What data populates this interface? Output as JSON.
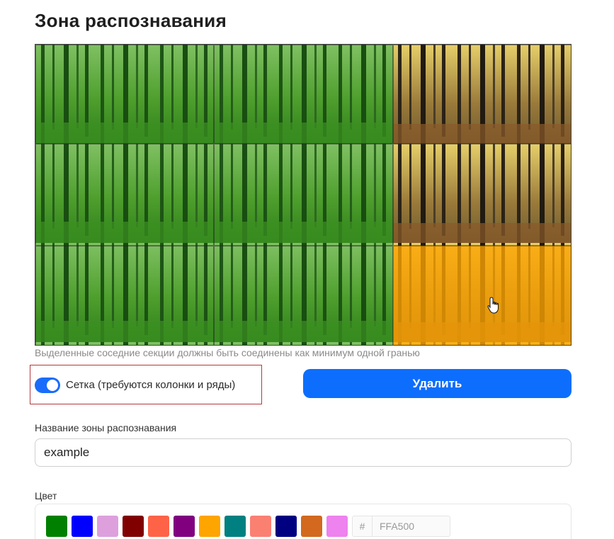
{
  "title": "Зона распознавания",
  "zone": {
    "grid_rows": 3,
    "grid_cols": 3,
    "selected_cells": [
      [
        0,
        2
      ],
      [
        1,
        2
      ],
      [
        2,
        2
      ]
    ],
    "highlighted_cell": [
      2,
      2
    ]
  },
  "hint": "Выделенные соседние секции должны быть соединены как минимум одной гранью",
  "grid_toggle": {
    "label": "Сетка (требуются колонки и ряды)",
    "checked": true
  },
  "delete_button": {
    "label": "Удалить"
  },
  "name_field": {
    "label": "Название зоны распознавания",
    "value": "example"
  },
  "color_field": {
    "label": "Цвет",
    "swatches": [
      {
        "name": "green",
        "hex": "#008000"
      },
      {
        "name": "blue",
        "hex": "#0000FF"
      },
      {
        "name": "plum",
        "hex": "#DDA0DD"
      },
      {
        "name": "maroon",
        "hex": "#800000"
      },
      {
        "name": "tomato",
        "hex": "#FF6347"
      },
      {
        "name": "purple",
        "hex": "#800080"
      },
      {
        "name": "orange",
        "hex": "#FFA500"
      },
      {
        "name": "teal",
        "hex": "#008080"
      },
      {
        "name": "salmon",
        "hex": "#FA8072"
      },
      {
        "name": "navy",
        "hex": "#000080"
      },
      {
        "name": "chocolate",
        "hex": "#D2691E"
      },
      {
        "name": "violet",
        "hex": "#EE82EE"
      }
    ],
    "hex_prefix": "#",
    "hex_value": "FFA500"
  }
}
